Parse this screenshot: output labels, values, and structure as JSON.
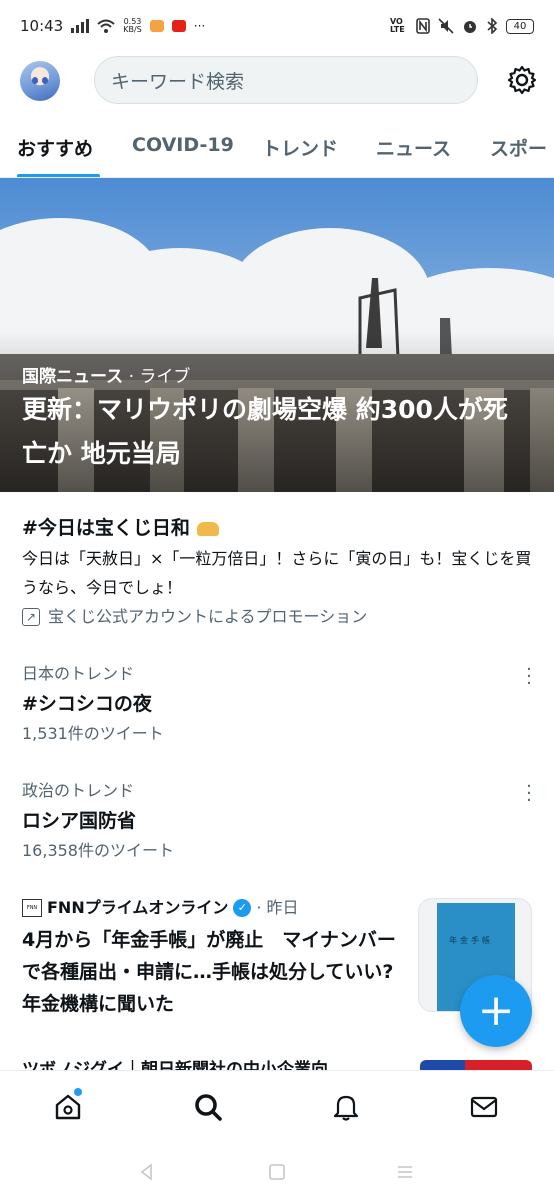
{
  "status_bar": {
    "time": "10:43",
    "net_speed_value": "0.53",
    "net_speed_unit": "KB/S",
    "more": "···",
    "network_type": "VO LTE",
    "battery": "40",
    "icons": [
      "signal-icon",
      "wifi-icon",
      "nfc-icon",
      "mute-icon",
      "alarm-icon",
      "bluetooth-icon",
      "battery-icon"
    ]
  },
  "header": {
    "search_placeholder": "キーワード検索",
    "icons": [
      "avatar",
      "gear-icon"
    ]
  },
  "tabs": [
    {
      "label": "おすすめ",
      "active": true
    },
    {
      "label": "COVID-19",
      "active": false
    },
    {
      "label": "トレンド",
      "active": false
    },
    {
      "label": "ニュース",
      "active": false
    },
    {
      "label": "スポー",
      "active": false
    }
  ],
  "hero": {
    "category": "国際ニュース",
    "separator": "·",
    "status": "ライブ",
    "title": "更新：マリウポリの劇場空爆 約300人が死亡か 地元当局"
  },
  "promo": {
    "title": "#今日は宝くじ日和",
    "body": "今日は「天赦日」×「一粒万倍日」！さらに「寅の日」も！宝くじを買うなら、今日でしょ！",
    "tag": "宝くじ公式アカウントによるプロモーション"
  },
  "trends": [
    {
      "category": "日本のトレンド",
      "name": "#シコシコの夜",
      "count": "1,531件のツイート"
    },
    {
      "category": "政治のトレンド",
      "name": "ロシア国防省",
      "count": "16,358件のツイート"
    }
  ],
  "news": {
    "source": "FNNプライムオンライン",
    "separator": "·",
    "time": "昨日",
    "title": "4月から「年金手帳」が廃止　マイナンバーで各種届出・申請に…手帳は処分していい?年金機構に聞いた",
    "thumb_text": "年金手帳"
  },
  "peek": {
    "text": "ツボノジグイ｜朝日新聞社の中小企業向"
  },
  "fab": {
    "label": "+"
  },
  "bottom_nav": [
    "home-icon",
    "search-icon",
    "bell-icon",
    "mail-icon"
  ],
  "colors": {
    "accent": "#1d9bf0",
    "text": "#0f1419",
    "muted": "#536471"
  }
}
